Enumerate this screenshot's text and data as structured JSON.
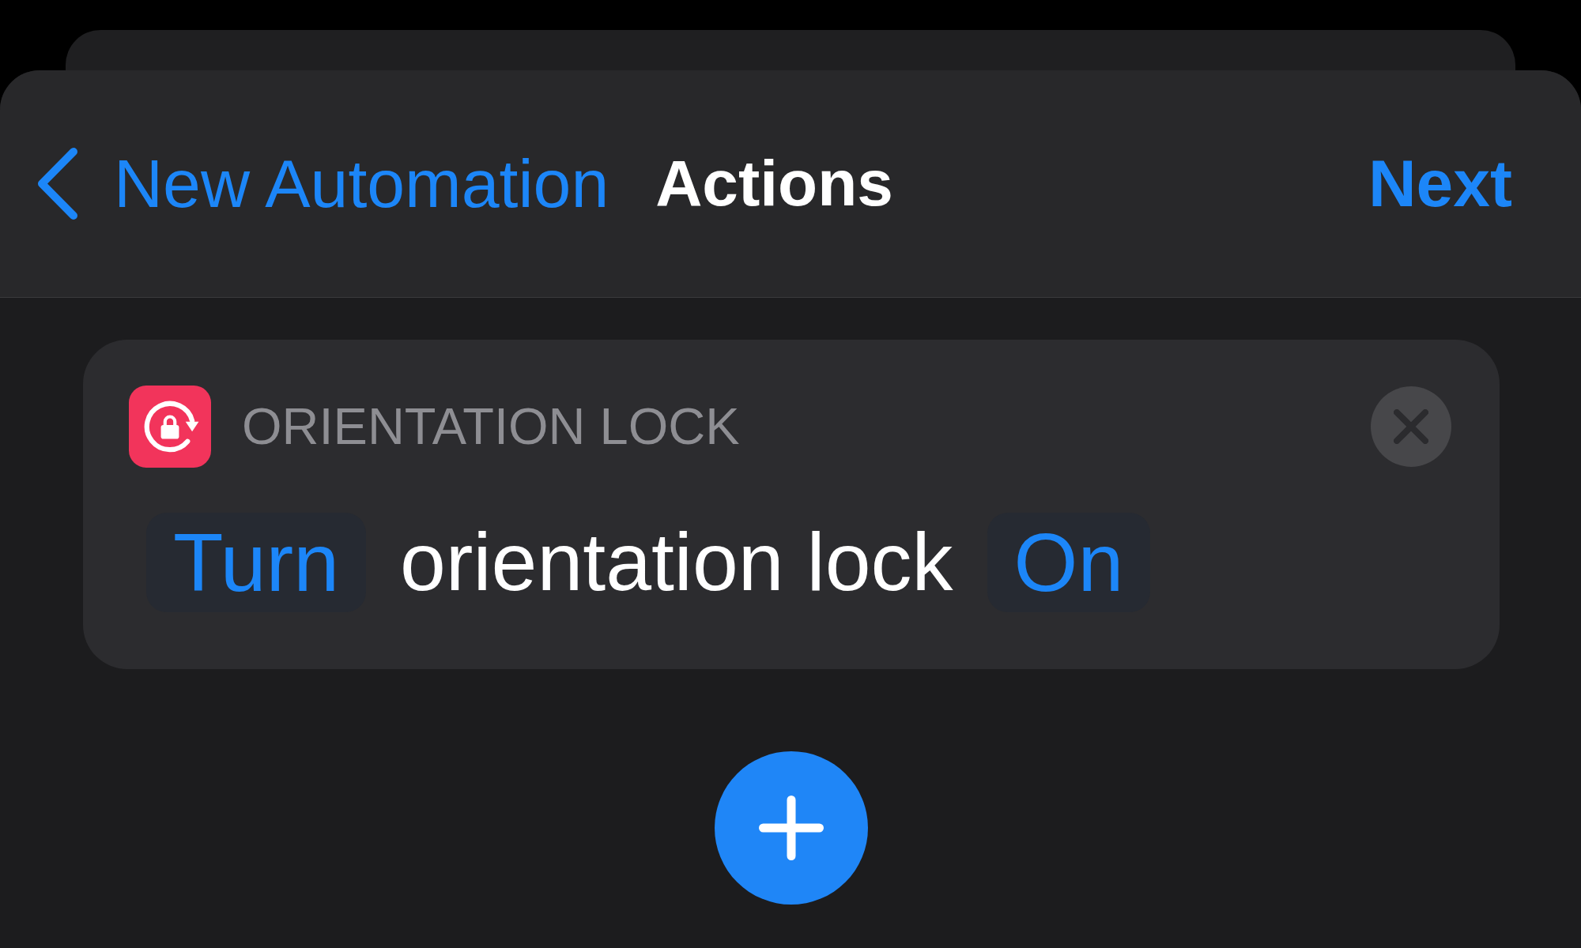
{
  "nav": {
    "back_label": "New Automation",
    "title": "Actions",
    "next_label": "Next"
  },
  "action": {
    "title": "ORIENTATION LOCK",
    "parts": [
      {
        "kind": "parameter",
        "text": "Turn"
      },
      {
        "kind": "text",
        "text": "orientation lock"
      },
      {
        "kind": "parameter",
        "text": "On"
      }
    ]
  }
}
